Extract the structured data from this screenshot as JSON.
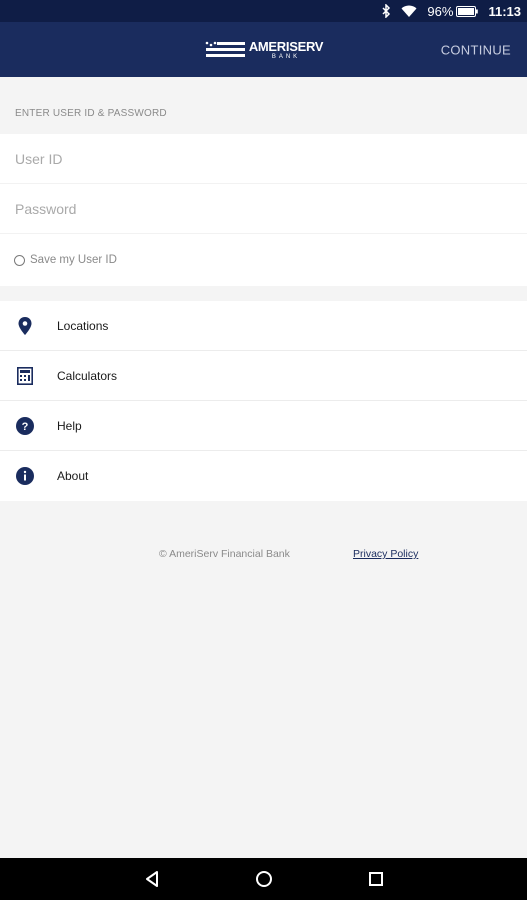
{
  "status_bar": {
    "battery_percent": "96%",
    "time": "11:13",
    "icons": [
      "bluetooth-icon",
      "wifi-icon",
      "battery-icon"
    ]
  },
  "app_bar": {
    "logo_text": "AMERISERV",
    "logo_subtext": "BANK",
    "continue_label": "CONTINUE"
  },
  "login": {
    "section_label": "ENTER USER ID & PASSWORD",
    "user_id_placeholder": "User ID",
    "user_id_value": "",
    "password_placeholder": "Password",
    "password_value": "",
    "save_user_id_label": "Save my User ID",
    "save_user_id_checked": false
  },
  "menu": {
    "items": [
      {
        "label": "Locations",
        "icon": "location-pin-icon"
      },
      {
        "label": "Calculators",
        "icon": "calculator-icon"
      },
      {
        "label": "Help",
        "icon": "help-icon"
      },
      {
        "label": "About",
        "icon": "info-icon"
      }
    ]
  },
  "footer": {
    "copyright": "© AmeriServ Financial Bank",
    "privacy_link": "Privacy Policy"
  },
  "nav_bar": {
    "buttons": [
      "back-icon",
      "home-icon",
      "recents-icon"
    ]
  },
  "colors": {
    "status_bar": "#0f1d46",
    "app_bar": "#1a2c5e",
    "icon_navy": "#1a2c5e",
    "background": "#f4f4f4"
  }
}
